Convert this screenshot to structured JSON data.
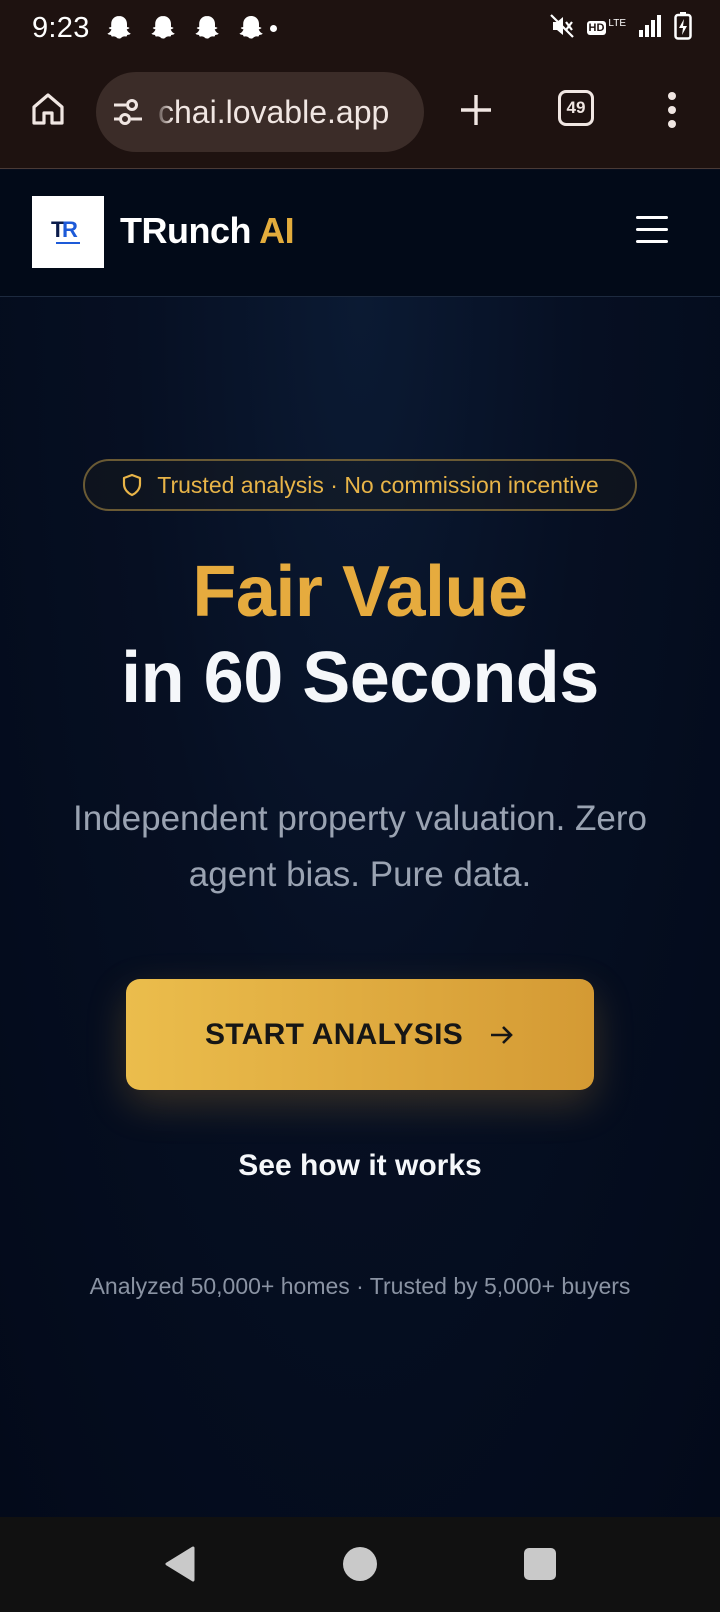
{
  "status_bar": {
    "time": "9:23",
    "notification_icons": [
      "snapchat-icon",
      "snapchat-icon",
      "snapchat-icon",
      "snapchat-icon"
    ],
    "network_label": "HD",
    "network_type": "LTE",
    "system_icons": [
      "mute-icon",
      "signal-icon",
      "battery-charging-icon"
    ]
  },
  "browser": {
    "url": "chai.lovable.app",
    "tab_count": "49"
  },
  "header": {
    "logo_text": "TR",
    "brand_name": "TRunch",
    "brand_suffix": "AI"
  },
  "hero": {
    "badge_text": "Trusted analysis · No commission incentive",
    "headline_line1": "Fair Value",
    "headline_line2": "in 60 Seconds",
    "subtitle": "Independent property valuation. Zero agent bias. Pure data.",
    "cta_label": "START ANALYSIS",
    "secondary_link": "See how it works",
    "stats_text": "Analyzed 50,000+ homes · Trusted by 5,000+ buyers"
  },
  "colors": {
    "accent_gold": "#e6ab3e",
    "background": "#050c1c",
    "browser_chrome": "#1e1210"
  }
}
